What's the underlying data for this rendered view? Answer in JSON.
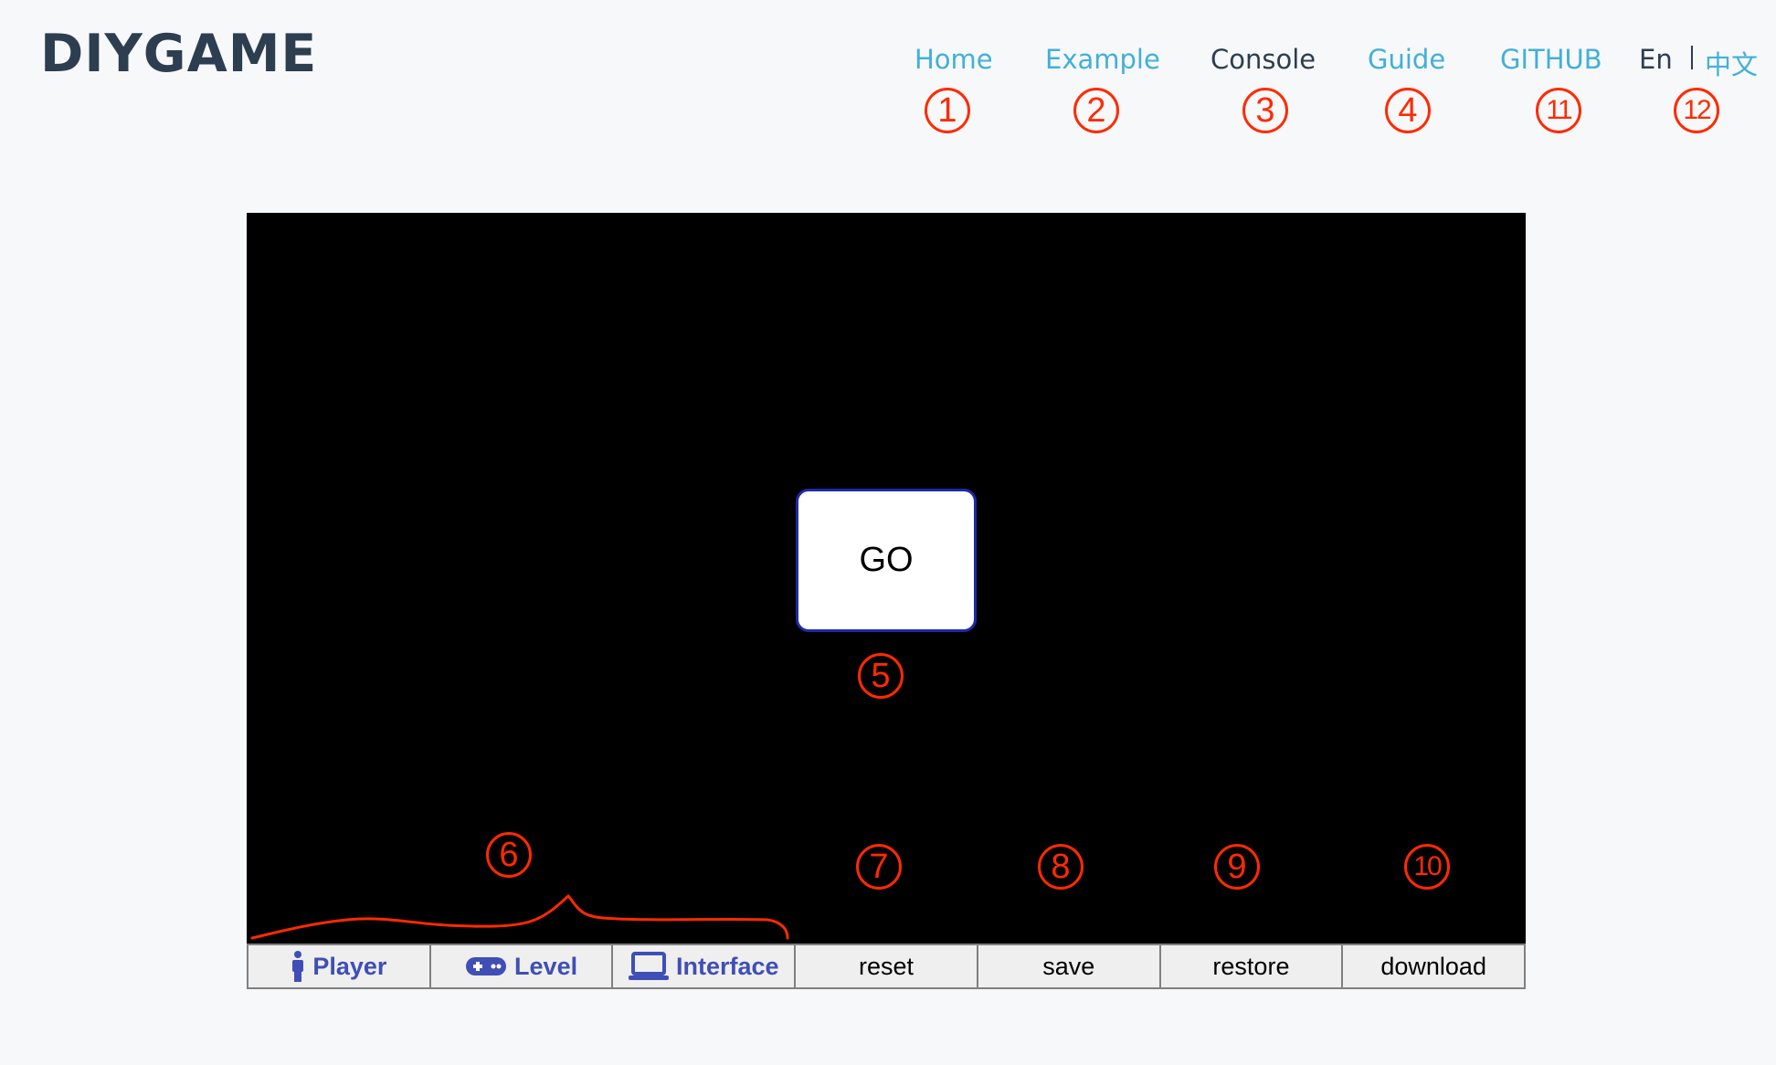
{
  "header": {
    "logo": "DIYGAME",
    "nav": [
      {
        "label": "Home"
      },
      {
        "label": "Example"
      },
      {
        "label": "Console"
      },
      {
        "label": "Guide"
      },
      {
        "label": "GITHUB"
      }
    ],
    "lang": {
      "en": "En",
      "zh": "中文"
    }
  },
  "game": {
    "go_label": "GO"
  },
  "toolbar": {
    "tabs": [
      {
        "label": "Player",
        "icon": "person-icon"
      },
      {
        "label": "Level",
        "icon": "gamepad-icon"
      },
      {
        "label": "Interface",
        "icon": "laptop-icon"
      }
    ],
    "actions": [
      {
        "label": "reset"
      },
      {
        "label": "save"
      },
      {
        "label": "restore"
      },
      {
        "label": "download"
      }
    ]
  },
  "annotations": [
    "1",
    "2",
    "3",
    "4",
    "5",
    "6",
    "7",
    "8",
    "9",
    "10",
    "11",
    "12"
  ],
  "colors": {
    "brand": "#2c3e50",
    "link": "#42b0d8",
    "annotation": "#ff2a00",
    "tab_text": "#3f4fb5"
  }
}
